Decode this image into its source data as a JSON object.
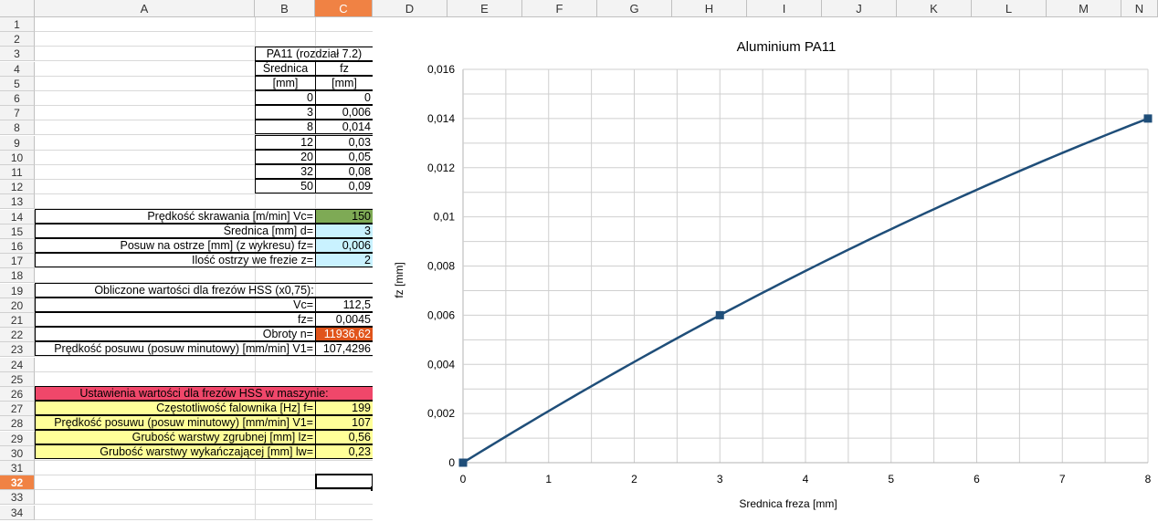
{
  "columns": [
    "A",
    "B",
    "C",
    "D",
    "E",
    "F",
    "G",
    "H",
    "I",
    "J",
    "K",
    "L",
    "M",
    "N"
  ],
  "rows": [
    "1",
    "2",
    "3",
    "4",
    "5",
    "6",
    "7",
    "8",
    "9",
    "10",
    "11",
    "12",
    "13",
    "14",
    "15",
    "16",
    "17",
    "18",
    "19",
    "20",
    "21",
    "22",
    "23",
    "24",
    "25",
    "26",
    "27",
    "28",
    "29",
    "30",
    "31",
    "32",
    "33",
    "34"
  ],
  "table": {
    "title": "PA11 (rozdział 7.2)",
    "col1_header": "Średnica",
    "col2_header": "fz",
    "col1_unit": "[mm]",
    "col2_unit": "[mm]",
    "data": [
      {
        "d": "0",
        "fz": "0"
      },
      {
        "d": "3",
        "fz": "0,006"
      },
      {
        "d": "8",
        "fz": "0,014"
      },
      {
        "d": "12",
        "fz": "0,03"
      },
      {
        "d": "20",
        "fz": "0,05"
      },
      {
        "d": "32",
        "fz": "0,08"
      },
      {
        "d": "50",
        "fz": "0,09"
      }
    ]
  },
  "inputs": [
    {
      "label": "Prędkość skrawania [m/min] Vc=",
      "value": "150"
    },
    {
      "label": "Średnica [mm] d=",
      "value": "3"
    },
    {
      "label": "Posuw na ostrze [mm] (z wykresu) fz=",
      "value": "0,006"
    },
    {
      "label": "Ilość ostrzy we frezie z=",
      "value": "2"
    }
  ],
  "calc": {
    "title": "Obliczone wartości dla frezów HSS (x0,75):",
    "vc_label": "Vc=",
    "vc_value": "112,5",
    "fz_label": "fz=",
    "fz_value": "0,0045",
    "n_label": "Obroty n=",
    "n_value": "11936,62",
    "v1_label": "Prędkość posuwu (posuw minutowy) [mm/min]  V1=",
    "v1_value": "107,4296"
  },
  "settings": {
    "title": "Ustawienia wartości dla frezów HSS w maszynie:",
    "rows": [
      {
        "label": "Częstotliwość falownika [Hz] f=",
        "value": "199"
      },
      {
        "label": "Prędkość posuwu (posuw minutowy) [mm/min]  V1=",
        "value": "107"
      },
      {
        "label": "Grubość warstwy zgrubnej [mm]  lz=",
        "value": "0,56"
      },
      {
        "label": "Grubość warstwy wykańczającej [mm] lw=",
        "value": "0,23"
      }
    ]
  },
  "chart_data": {
    "type": "line",
    "title": "Aluminium PA11",
    "xlabel": "Srednica freza [mm]",
    "ylabel": "fz [mm]",
    "x": [
      0,
      3,
      8
    ],
    "series": [
      {
        "values": [
          0,
          0.006,
          0.014
        ]
      }
    ],
    "xlim": [
      0,
      8
    ],
    "ylim": [
      0,
      0.016
    ],
    "xticks": [
      "0",
      "1",
      "2",
      "3",
      "4",
      "5",
      "6",
      "7",
      "8"
    ],
    "yticks": [
      "0",
      "0,002",
      "0,004",
      "0,006",
      "0,008",
      "0,01",
      "0,012",
      "0,014",
      "0,016"
    ],
    "grid": true,
    "line_color": "#1f4e79",
    "marker_color": "#1f4e79"
  }
}
